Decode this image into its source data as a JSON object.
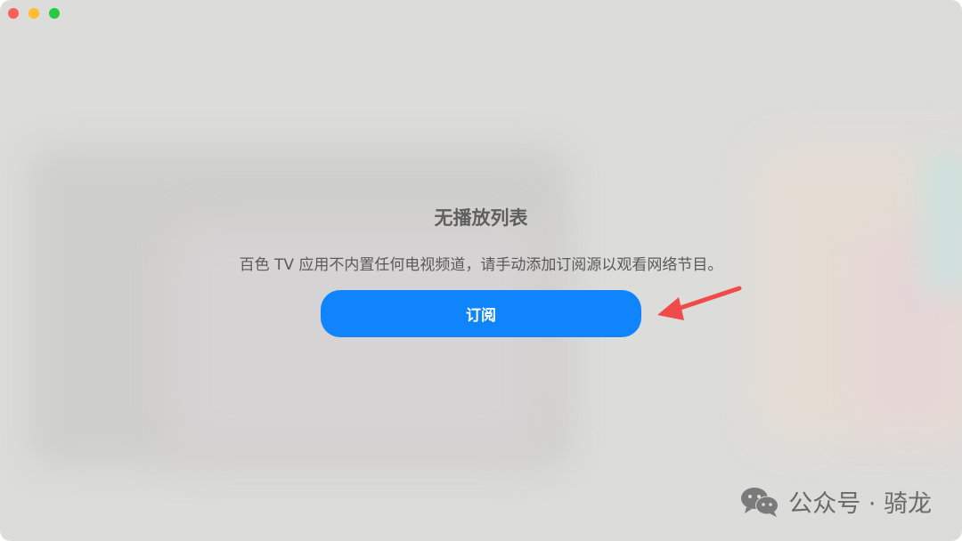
{
  "window": {
    "controls": [
      "close",
      "minimize",
      "maximize"
    ]
  },
  "empty_state": {
    "title": "无播放列表",
    "message": "百色 TV 应用不内置任何电视频道，请手动添加订阅源以观看网络节目。",
    "subscribe_label": "订阅"
  },
  "watermark": {
    "text": "公众号 · 骑龙",
    "icon": "wechat-icon"
  },
  "colors": {
    "accent": "#1084fb",
    "arrow": "#f04a4a",
    "close": "#fe5f57",
    "minimize": "#febc2e",
    "maximize": "#28c840"
  }
}
